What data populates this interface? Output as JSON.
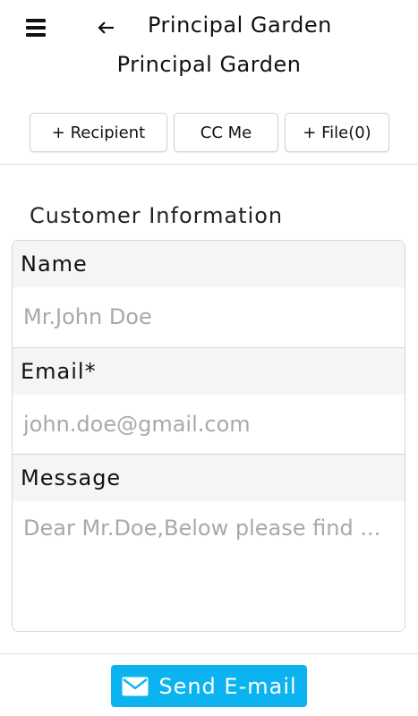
{
  "header": {
    "title": "Principal Garden",
    "menu_icon": "hamburger-menu-icon",
    "back_icon": "arrow-left-icon"
  },
  "page_title": "Principal Garden",
  "actions": {
    "recipient_label": "+ Recipient",
    "cc_me_label": "CC Me",
    "file_label": "+ File(0)"
  },
  "section_title": "Customer Information",
  "form": {
    "name": {
      "label": "Name",
      "value": "",
      "placeholder": "Mr.John Doe"
    },
    "email": {
      "label": "Email*",
      "value": "",
      "placeholder": "john.doe@gmail.com"
    },
    "message": {
      "label": "Message",
      "value": "",
      "placeholder": "Dear Mr.Doe,Below please find ..."
    }
  },
  "send": {
    "label": "Send E-mail",
    "icon": "envelope-icon",
    "color": "#0bb4f0"
  }
}
